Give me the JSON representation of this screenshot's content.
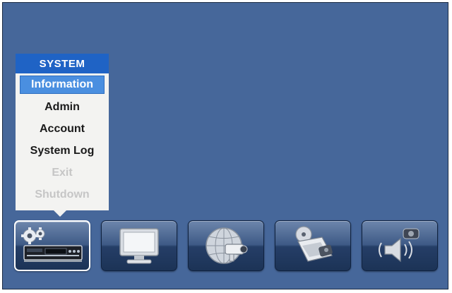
{
  "menu": {
    "title": "SYSTEM",
    "items": [
      {
        "label": "Information",
        "state": "selected"
      },
      {
        "label": "Admin",
        "state": "enabled"
      },
      {
        "label": "Account",
        "state": "enabled"
      },
      {
        "label": "System Log",
        "state": "enabled"
      },
      {
        "label": "Exit",
        "state": "disabled"
      },
      {
        "label": "Shutdown",
        "state": "disabled"
      }
    ]
  },
  "toolbar": {
    "buttons": [
      {
        "icon": "system-gear-dvr-icon",
        "active": true
      },
      {
        "icon": "monitor-display-icon",
        "active": false
      },
      {
        "icon": "network-globe-camera-icon",
        "active": false
      },
      {
        "icon": "record-storage-disc-icon",
        "active": false
      },
      {
        "icon": "event-alarm-speaker-icon",
        "active": false
      }
    ]
  },
  "colors": {
    "background": "#46679a",
    "menu_header": "#1f63c5",
    "menu_selected": "#4a8fe0",
    "menu_disabled_text": "#c6c6c6"
  }
}
